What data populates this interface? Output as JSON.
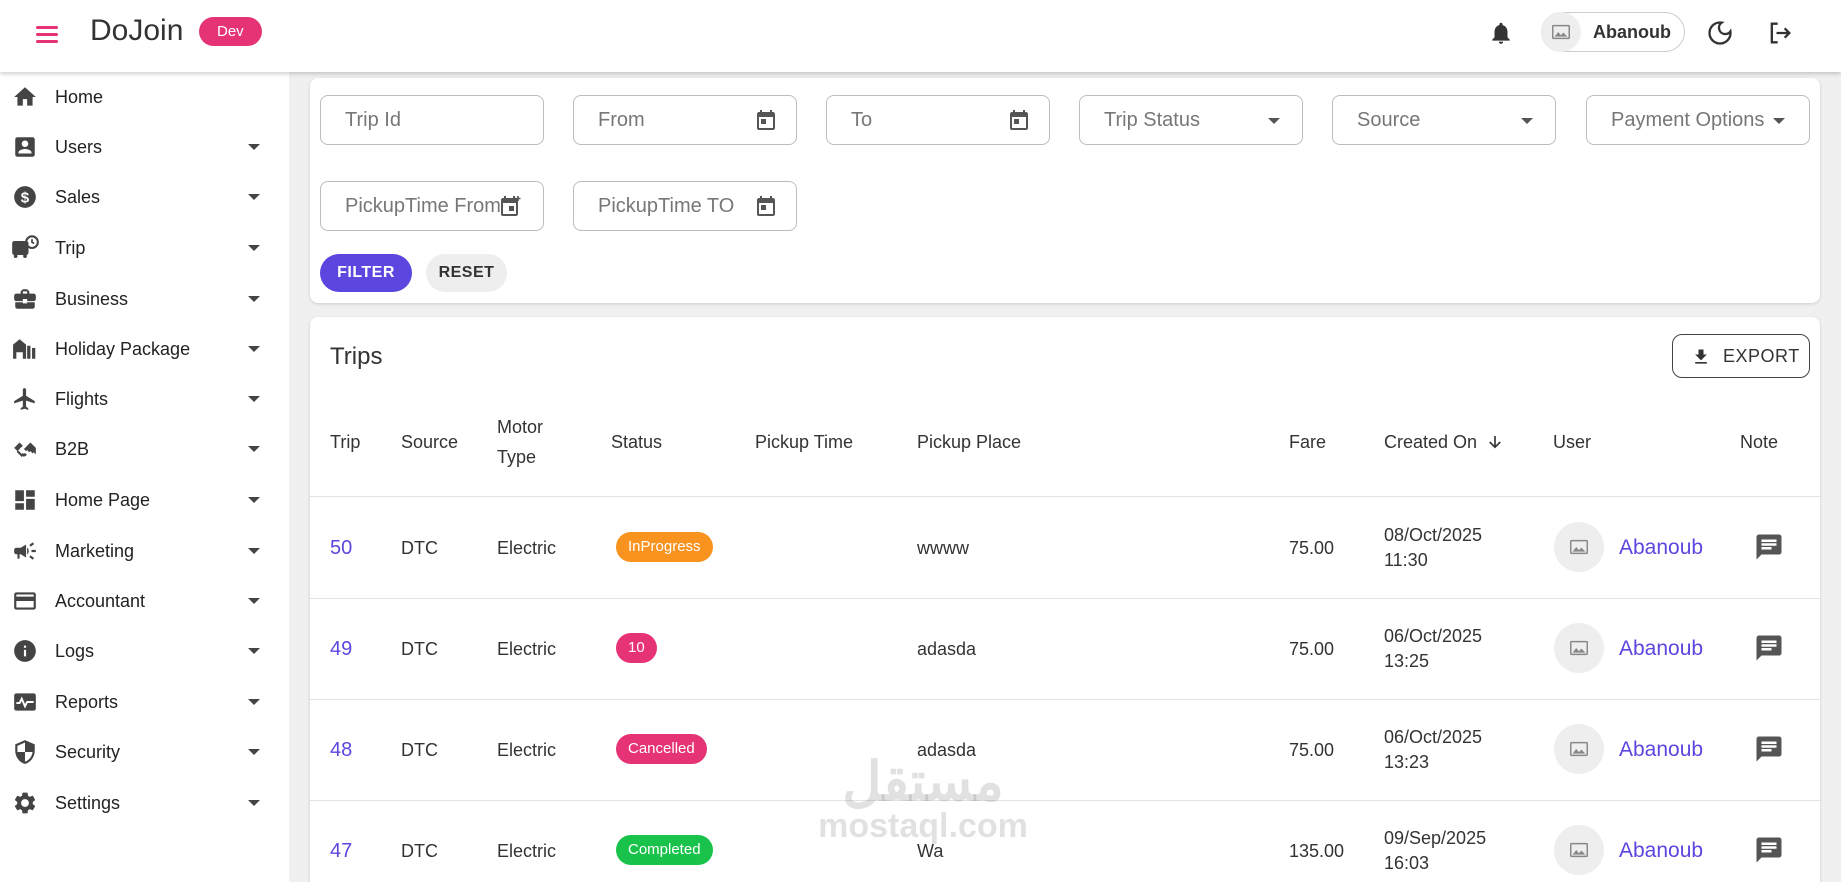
{
  "header": {
    "brand": "DoJoin",
    "env_badge": "Dev",
    "user_name": "Abanoub",
    "icons": [
      "menu-icon",
      "bell-icon",
      "image-icon",
      "moon-icon",
      "logout-icon"
    ]
  },
  "sidebar": {
    "items": [
      {
        "label": "Home",
        "icon": "home-icon"
      },
      {
        "label": "Users",
        "icon": "user-card-icon"
      },
      {
        "label": "Sales",
        "icon": "dollar-icon"
      },
      {
        "label": "Trip",
        "icon": "bus-clock-icon"
      },
      {
        "label": "Business",
        "icon": "briefcase-icon"
      },
      {
        "label": "Holiday Package",
        "icon": "buildings-icon"
      },
      {
        "label": "Flights",
        "icon": "airplane-icon"
      },
      {
        "label": "B2B",
        "icon": "handshake-icon"
      },
      {
        "label": "Home Page",
        "icon": "dashboard-icon"
      },
      {
        "label": "Marketing",
        "icon": "megaphone-icon"
      },
      {
        "label": "Accountant",
        "icon": "wallet-icon"
      },
      {
        "label": "Logs",
        "icon": "info-icon"
      },
      {
        "label": "Reports",
        "icon": "pulse-icon"
      },
      {
        "label": "Security",
        "icon": "shield-icon"
      },
      {
        "label": "Settings",
        "icon": "gear-icon"
      }
    ]
  },
  "filters": {
    "trip_id": "Trip Id",
    "from": "From",
    "to": "To",
    "trip_status": "Trip Status",
    "source": "Source",
    "payment_options": "Payment Options",
    "pickup_from": "PickupTime From",
    "pickup_to": "PickupTime TO",
    "filter_label": "FILTER",
    "reset_label": "RESET"
  },
  "trips": {
    "title": "Trips",
    "export_label": "EXPORT",
    "columns": {
      "trip": "Trip",
      "source": "Source",
      "motor_type_1": "Motor",
      "motor_type_2": "Type",
      "status": "Status",
      "pickup_time": "Pickup Time",
      "pickup_place": "Pickup Place",
      "fare": "Fare",
      "created_on": "Created On",
      "user": "User",
      "note": "Note"
    },
    "rows": [
      {
        "trip": "50",
        "source": "DTC",
        "motor": "Electric",
        "status": "InProgress",
        "status_color": "#f7931e",
        "pickup_place": "wwww",
        "fare": "75.00",
        "date": "08/Oct/2025",
        "time": "11:30",
        "user": "Abanoub"
      },
      {
        "trip": "49",
        "source": "DTC",
        "motor": "Electric",
        "status": "10",
        "status_color": "#e63375",
        "pickup_place": "adasda",
        "fare": "75.00",
        "date": "06/Oct/2025",
        "time": "13:25",
        "user": "Abanoub"
      },
      {
        "trip": "48",
        "source": "DTC",
        "motor": "Electric",
        "status": "Cancelled",
        "status_color": "#e63375",
        "pickup_place": "adasda",
        "fare": "75.00",
        "date": "06/Oct/2025",
        "time": "13:23",
        "user": "Abanoub"
      },
      {
        "trip": "47",
        "source": "DTC",
        "motor": "Electric",
        "status": "Completed",
        "status_color": "#19c24a",
        "pickup_place": "Wa",
        "fare": "135.00",
        "date": "09/Sep/2025",
        "time": "16:03",
        "user": "Abanoub"
      }
    ]
  },
  "watermark": {
    "line1": "مستقل",
    "line2": "mostaql.com"
  },
  "colors": {
    "accent": "#5b46e0",
    "brand_pink": "#e63375"
  }
}
